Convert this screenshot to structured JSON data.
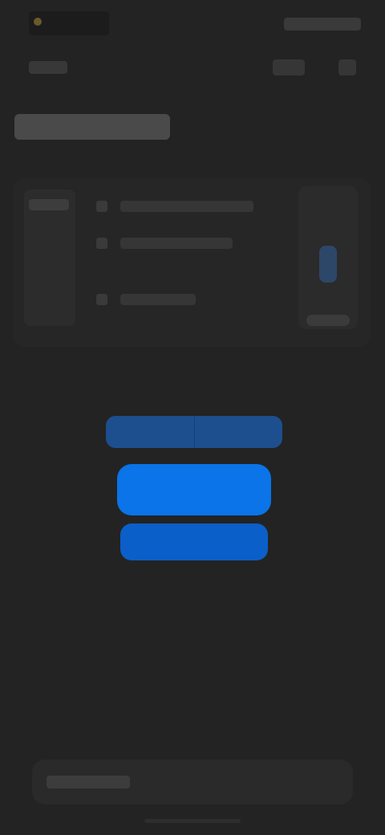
{
  "status_bar": {
    "time": "",
    "indicators": ""
  },
  "nav_bar": {
    "back_label": "",
    "action_labels": [
      "",
      ""
    ]
  },
  "page": {
    "title": ""
  },
  "card": {
    "left_label": "",
    "rows": [
      "",
      "",
      ""
    ],
    "right_label": ""
  },
  "button_group": {
    "segments": [
      "",
      ""
    ],
    "primary_label": "",
    "secondary_label": ""
  },
  "bottom_bar": {
    "label": ""
  },
  "colors": {
    "background": "#232323",
    "card": "#262626",
    "primary_blue": "#0a74e8",
    "secondary_blue": "#0b5fc8",
    "segment_blue": "#1d4f8f",
    "status_accent": "#6b5a2a"
  },
  "icons": {
    "status_left": "status-dot-icon",
    "nav_back": "back-icon",
    "card_bullets": "bullet-icon"
  }
}
